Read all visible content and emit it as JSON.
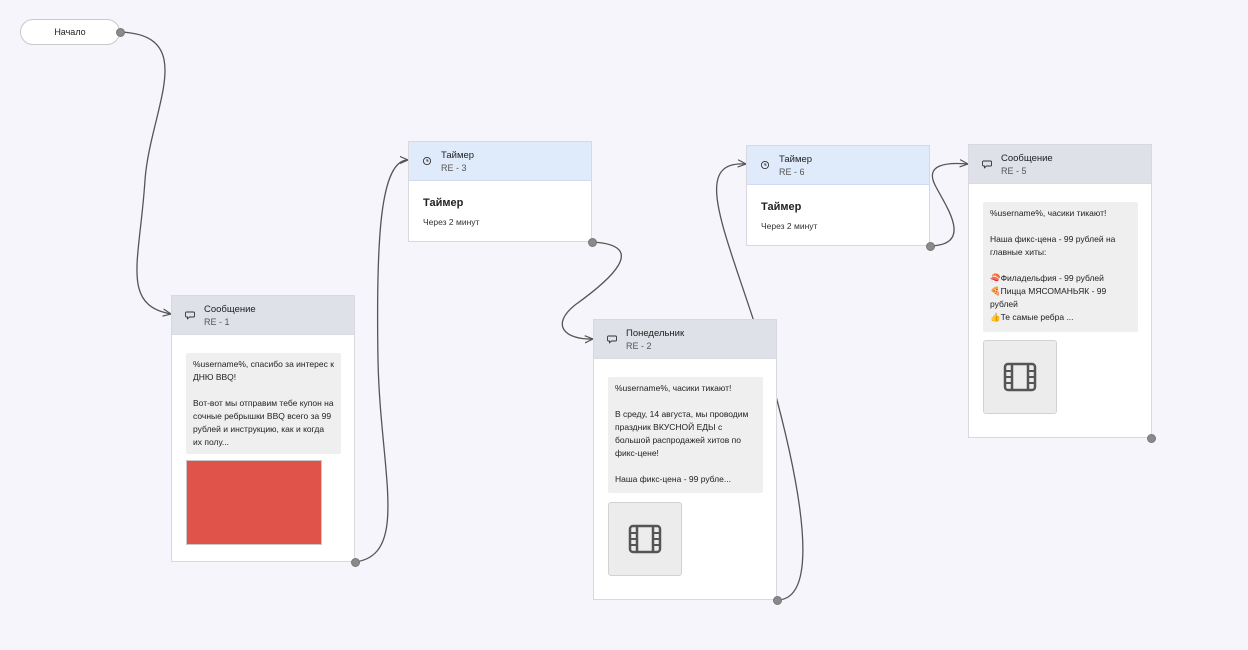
{
  "start": {
    "label": "Начало"
  },
  "nodes": {
    "msg1": {
      "title": "Сообщение",
      "subtitle": "RE - 1",
      "text": "%username%, спасибо за интерес к ДНЮ BBQ!\n\nВот-вот мы отправим тебе купон на сочные ребрышки BBQ всего за 99 рублей и инструкцию, как и когда их полу...",
      "media": "red-image"
    },
    "timer3": {
      "title": "Таймер",
      "subtitle": "RE - 3",
      "body_title": "Таймер",
      "body_text": "Через 2 минут"
    },
    "monday2": {
      "title": "Понедельник",
      "subtitle": "RE - 2",
      "text": "%username%, часики тикают!\n\nВ среду, 14 августа, мы проводим праздник ВКУСНОЙ ЕДЫ с большой распродажей хитов по фикс-цене!\n\nНаша фикс-цена - 99 рубле...",
      "media": "video-icon"
    },
    "timer6": {
      "title": "Таймер",
      "subtitle": "RE - 6",
      "body_title": "Таймер",
      "body_text": "Через 2 минут"
    },
    "msg5": {
      "title": "Сообщение",
      "subtitle": "RE - 5",
      "text": "%username%, часики тикают!\n\nНаша фикс-цена - 99 рублей на главные хиты:\n\n🍣Филадельфия - 99 рублей\n🍕Пицца МЯСОМАНЬЯК - 99 рублей\n👍Те самые ребра ...",
      "media": "video-icon"
    }
  },
  "icons": {
    "message": "chat-bubble-icon",
    "timer": "clock-icon",
    "video": "film-icon"
  },
  "colors": {
    "background": "#f7f5fc",
    "message_header": "#dee1e8",
    "timer_header": "#dfeafb",
    "image_placeholder": "#e0534a",
    "connector": "#555555"
  }
}
